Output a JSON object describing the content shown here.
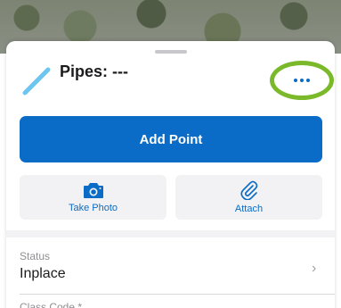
{
  "feature": {
    "title": "Pipes: ---",
    "icon": "pipe-line-icon",
    "icon_color": "#6ec6f0"
  },
  "actions": {
    "more_icon": "ellipsis-icon",
    "add_point_label": "Add Point",
    "take_photo_label": "Take Photo",
    "take_photo_icon": "camera-icon",
    "attach_label": "Attach",
    "attach_icon": "paperclip-icon"
  },
  "fields": [
    {
      "label": "Status",
      "value": "Inplace",
      "chevron_icon": "chevron-right-icon"
    },
    {
      "label": "Class Code *"
    }
  ],
  "colors": {
    "accent": "#0a6cc6",
    "highlight_ring": "#7ab929"
  }
}
